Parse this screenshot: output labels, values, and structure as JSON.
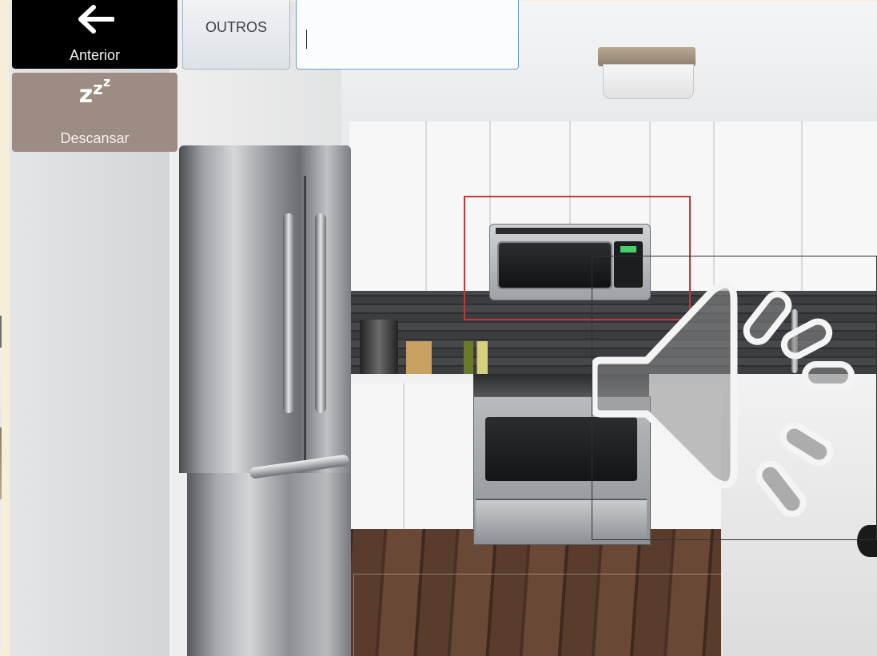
{
  "toolbar": {
    "previous_label": "Anterior",
    "rest_label": "Descansar",
    "others_label": "OUTROS"
  },
  "text_input": {
    "value": ""
  },
  "icons": {
    "previous": "arrow-left-icon",
    "rest": "sleep-zzz-icon",
    "speaker": "speaker-sound-icon"
  },
  "colors": {
    "page_background": "#f5eed8",
    "previous_button": "#000000",
    "rest_button": "#9c8c83",
    "highlight_border": "#c0393b"
  }
}
